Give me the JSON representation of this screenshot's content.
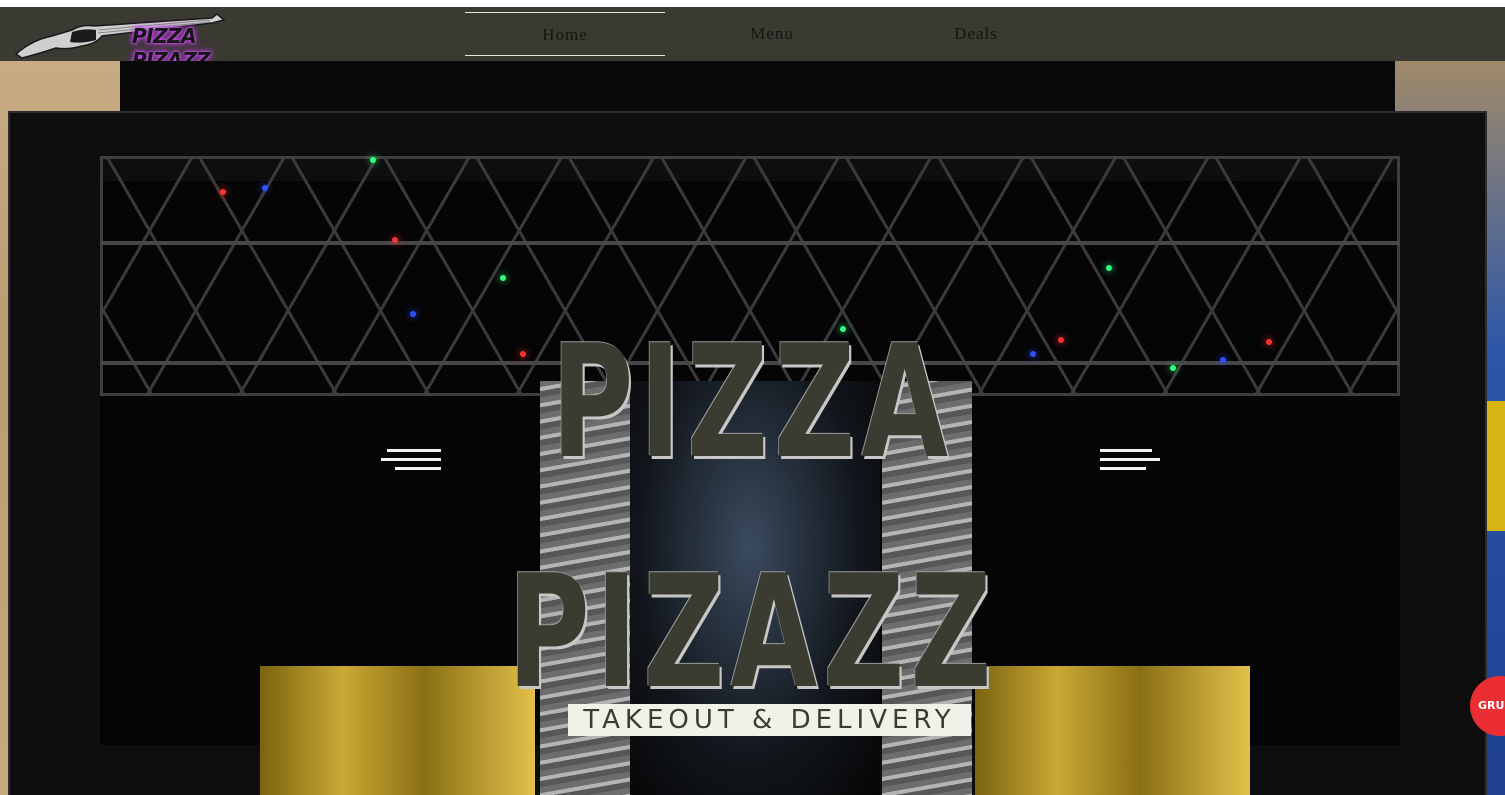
{
  "header": {
    "logo_text": "PIZZA PIZAZZ",
    "nav": [
      {
        "label": "Home",
        "active": true
      },
      {
        "label": "Menu",
        "active": false
      },
      {
        "label": "Deals",
        "active": false
      }
    ]
  },
  "hero": {
    "title_line1": "PIZZA",
    "title_line2": "PIZAZZ",
    "tagline": "TAKEOUT & DELIVERY",
    "left_menu_icon": "menu-lines-icon",
    "right_menu_icon": "menu-lines-icon"
  },
  "grubhub_badge": "GRUBHUB",
  "colors": {
    "header_bg": "#3a3a33",
    "title_text": "#3a3b31",
    "tagline_bg": "#f1f1ea",
    "logo_glow": "#d14cff",
    "grubhub_red": "#ea2e33"
  }
}
